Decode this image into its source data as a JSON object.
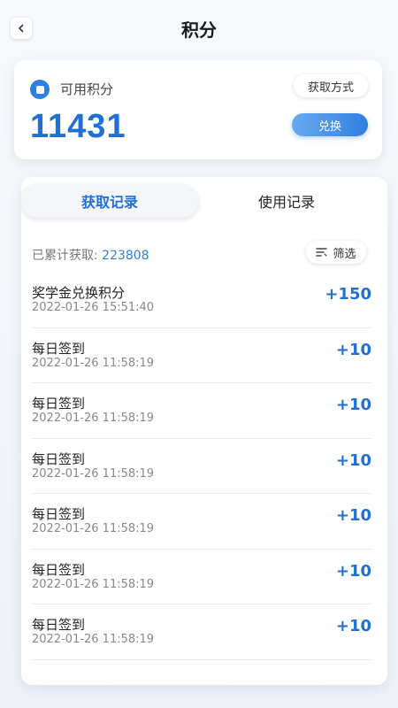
{
  "header": {
    "title": "积分",
    "back_icon": "chevron-left-icon"
  },
  "points": {
    "label": "可用积分",
    "value": "11431",
    "earn_method_label": "获取方式",
    "exchange_label": "兑换",
    "accent_color": "#2f7fe0"
  },
  "records": {
    "tabs": [
      {
        "label": "获取记录",
        "active": true
      },
      {
        "label": "使用记录",
        "active": false
      }
    ],
    "summary_label": "已累计获取:",
    "summary_value": "223808",
    "filter_label": "筛选",
    "items": [
      {
        "name": "奖学金兑换积分",
        "time": "2022-01-26 15:51:40",
        "amount": "+150"
      },
      {
        "name": "每日签到",
        "time": "2022-01-26 11:58:19",
        "amount": "+10"
      },
      {
        "name": "每日签到",
        "time": "2022-01-26 11:58:19",
        "amount": "+10"
      },
      {
        "name": "每日签到",
        "time": "2022-01-26 11:58:19",
        "amount": "+10"
      },
      {
        "name": "每日签到",
        "time": "2022-01-26 11:58:19",
        "amount": "+10"
      },
      {
        "name": "每日签到",
        "time": "2022-01-26 11:58:19",
        "amount": "+10"
      },
      {
        "name": "每日签到",
        "time": "2022-01-26 11:58:19",
        "amount": "+10"
      }
    ]
  }
}
